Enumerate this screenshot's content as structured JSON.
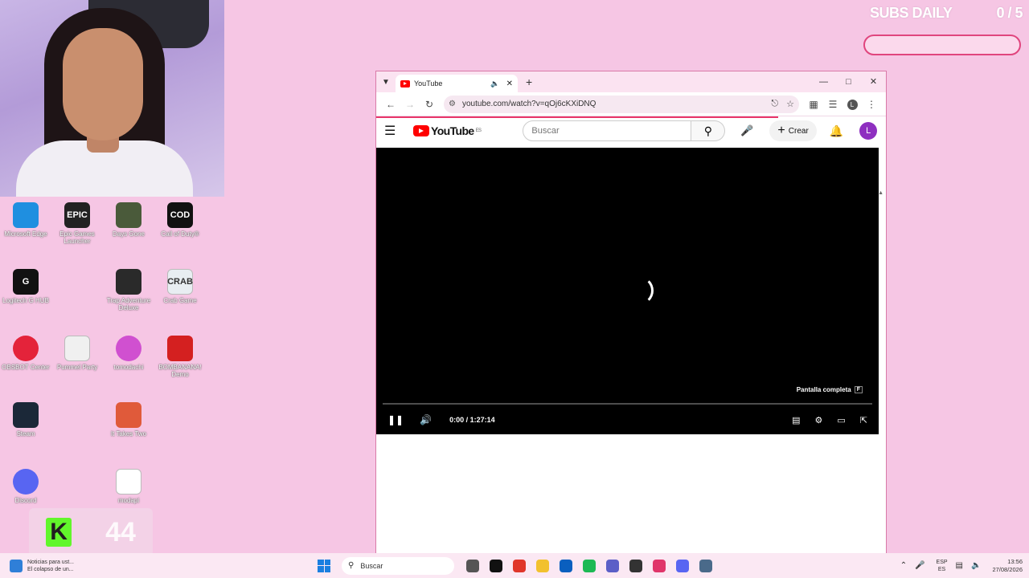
{
  "overlay": {
    "subs_label": "SUBS DAILY",
    "subs_count": "0 / 5",
    "kick_letter": "K",
    "kick_count": "44"
  },
  "desktop_icons": [
    {
      "label": "Microsoft Edge",
      "color": "#1f8fe0"
    },
    {
      "label": "Epic Games Launcher",
      "color": "#222222",
      "glyph": "EPIC"
    },
    {
      "label": "Days Gone",
      "color": "#4a5a3a"
    },
    {
      "label": "Call of Duty®",
      "color": "#111111",
      "glyph": "COD"
    },
    {
      "label": "Logitech G HUB",
      "color": "#111111",
      "glyph": "G"
    },
    {
      "label": "Trap Adventure Deluxe",
      "color": "#2a2a2a"
    },
    {
      "label": "Crab Game",
      "color": "#e8eef2",
      "glyph": "CRAB"
    },
    {
      "label": "OBSBOT Center",
      "color": "#e4233a"
    },
    {
      "label": "Pummel Party",
      "color": "#f0f0f0"
    },
    {
      "label": "tomodachi",
      "color": "#d050d0"
    },
    {
      "label": "BOMBANANA! Demo",
      "color": "#d42020"
    },
    {
      "label": "Steam",
      "color": "#1b2838"
    },
    {
      "label": "It Takes Two",
      "color": "#e05a3a"
    },
    {
      "label": "Discord",
      "color": "#5865f2"
    },
    {
      "label": "modapi",
      "color": "#ffffff"
    }
  ],
  "browser": {
    "tab_title": "YouTube",
    "url": "youtube.com/watch?v=qOj6cKXiDNQ",
    "profile_initial": "L"
  },
  "youtube": {
    "logo_text": "YouTube",
    "region": "ES",
    "search_placeholder": "Buscar",
    "create_label": "Crear",
    "avatar_initial": "L",
    "fullscreen_tooltip": "Pantalla completa",
    "fullscreen_key": "F",
    "time": "0:00 / 1:27:14"
  },
  "taskbar": {
    "news_title": "Noticias para ust...",
    "news_sub": "El colapso de un...",
    "search_label": "Buscar",
    "lang_top": "ESP",
    "lang_bottom": "ES",
    "time": "13:56",
    "date": "27/08/2026",
    "apps": [
      "#555555",
      "#111111",
      "#e0362a",
      "#f2c12e",
      "#0a5fbf",
      "#1db954",
      "#5b5fc7",
      "#333333",
      "#e0356a",
      "#5865f2",
      "#4a6a8a"
    ]
  }
}
